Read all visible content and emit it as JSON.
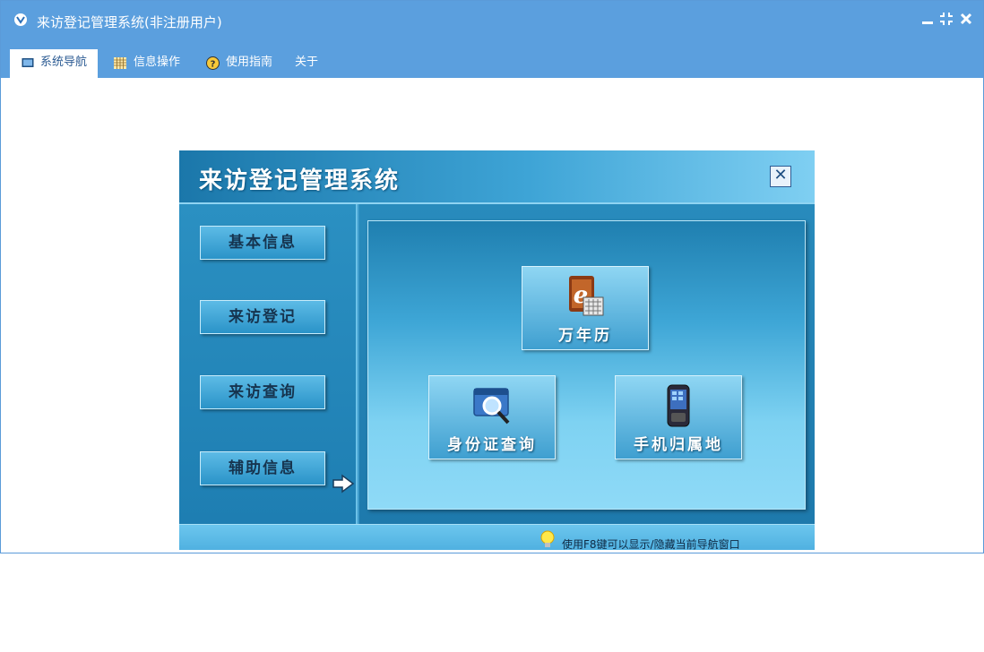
{
  "window": {
    "title": "来访登记管理系统(非注册用户)",
    "controls": [
      "minimize",
      "restore",
      "close"
    ]
  },
  "menu": {
    "tabs": [
      {
        "label": "系统导航",
        "icon": "monitor-icon",
        "active": true
      },
      {
        "label": "信息操作",
        "icon": "grid-icon",
        "active": false
      },
      {
        "label": "使用指南",
        "icon": "help-icon",
        "active": false
      },
      {
        "label": "关于",
        "icon": "",
        "active": false
      }
    ]
  },
  "navigator": {
    "title": "来访登记管理系统",
    "close_label": "✕",
    "side_buttons": [
      {
        "label": "基本信息"
      },
      {
        "label": "来访登记"
      },
      {
        "label": "来访查询"
      },
      {
        "label": "辅助信息",
        "selected": true
      }
    ],
    "tiles": [
      {
        "label": "万年历",
        "icon": "calendar-icon"
      },
      {
        "label": "身份证查询",
        "icon": "id-card-search-icon"
      },
      {
        "label": "手机归属地",
        "icon": "mobile-phone-icon"
      }
    ],
    "footer_tip": "使用F8键可以显示/隐藏当前导航窗口"
  },
  "colors": {
    "titlebar": "#5b9fde",
    "panel_dark": "#1f7fb0",
    "panel_light": "#8fdaf7",
    "button_text": "#16344f"
  }
}
